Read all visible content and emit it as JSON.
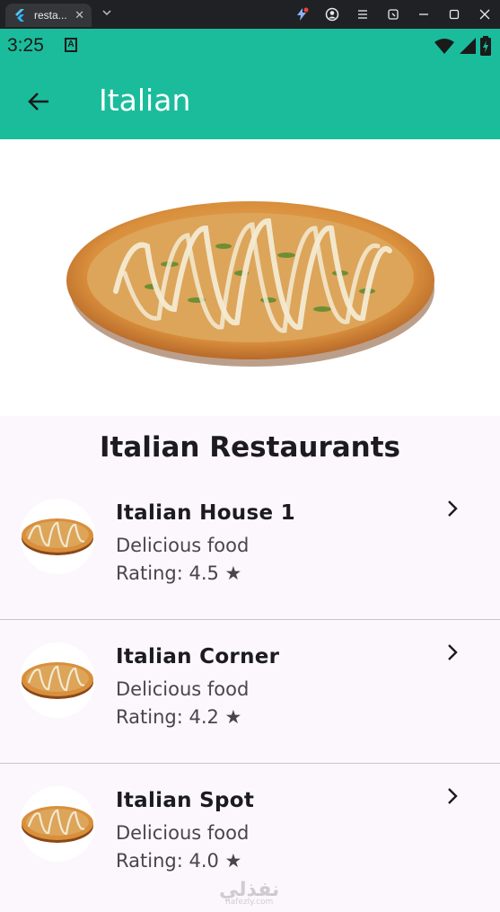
{
  "browser": {
    "tab_title": "resta...",
    "tab_close": "✕",
    "colors": {
      "bar": "#202124",
      "tab": "#35363a"
    }
  },
  "status": {
    "time": "3:25",
    "notif_letter": "A"
  },
  "app_bar": {
    "title": "Italian",
    "color": "#1abc9c"
  },
  "section": {
    "title": "Italian Restaurants"
  },
  "restaurants": [
    {
      "name": "Italian House 1",
      "subtitle": "Delicious food",
      "rating": "Rating: 4.5 ★"
    },
    {
      "name": "Italian Corner",
      "subtitle": "Delicious food",
      "rating": "Rating: 4.2 ★"
    },
    {
      "name": "Italian Spot",
      "subtitle": "Delicious food",
      "rating": "Rating: 4.0 ★"
    }
  ],
  "watermark": {
    "line1": "نفذلي",
    "line2": "nafezly.com"
  },
  "icons": [
    "flutter-icon",
    "chevron-down-icon",
    "extension-icon",
    "profile-icon",
    "menu-icon",
    "cast-icon",
    "minimize-icon",
    "maximize-icon",
    "close-icon",
    "wifi-icon",
    "signal-icon",
    "battery-icon",
    "back-arrow-icon",
    "chevron-right-icon"
  ]
}
